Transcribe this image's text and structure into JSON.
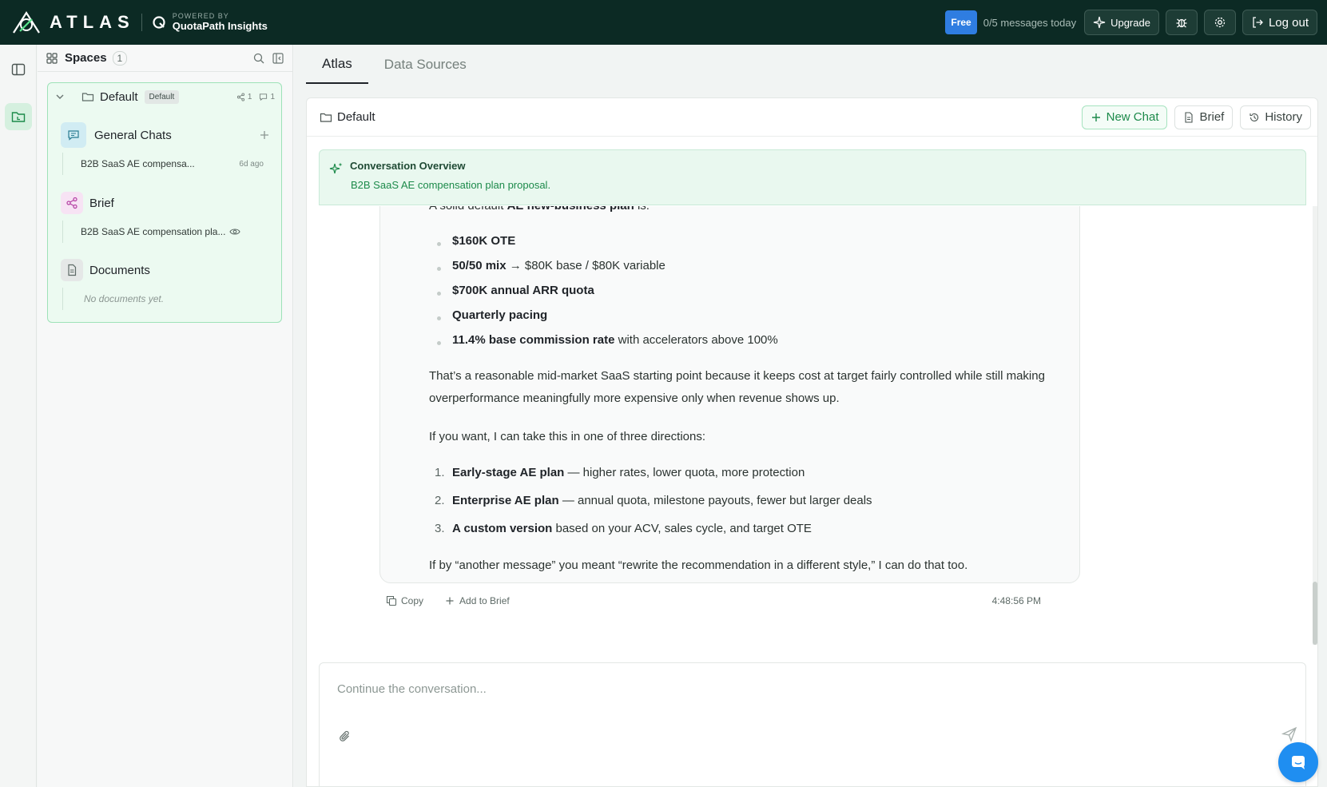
{
  "brand": {
    "name": "ATLAS",
    "powered_by": "POWERED BY",
    "partner": "QuotaPath Insights"
  },
  "topbar": {
    "plan_badge": "Free",
    "message_count": "0/5 messages today",
    "upgrade_label": "Upgrade",
    "logout_label": "Log out",
    "icons": [
      "bug-icon",
      "gear-icon",
      "logout-icon"
    ]
  },
  "sidebar": {
    "title": "Spaces",
    "count": "1",
    "space": {
      "name": "Default",
      "badge": "Default",
      "share_count": "1",
      "chat_count": "1"
    },
    "sections": [
      {
        "title": "General Chats",
        "items": [
          {
            "label": "B2B SaaS AE compensa...",
            "time": "6d ago"
          }
        ]
      },
      {
        "title": "Brief",
        "items": [
          {
            "label": "B2B SaaS AE compensation pla..."
          }
        ]
      },
      {
        "title": "Documents",
        "empty": "No documents yet."
      }
    ]
  },
  "main": {
    "tabs": [
      {
        "label": "Atlas",
        "active": true
      },
      {
        "label": "Data Sources",
        "active": false
      }
    ],
    "panel_title": "Default",
    "actions": {
      "new_chat": "New Chat",
      "brief": "Brief",
      "history": "History"
    },
    "overview": {
      "title": "Conversation Overview",
      "text": "B2B SaaS AE compensation plan proposal."
    },
    "message": {
      "intro_pre": "A solid default ",
      "intro_bold": "AE new-business plan",
      "intro_post": " is:",
      "bullets": [
        {
          "bold": "$160K OTE",
          "rest": ""
        },
        {
          "bold": "50/50 mix",
          "rest": " → $80K base / $80K variable"
        },
        {
          "bold": "$700K annual ARR quota",
          "rest": ""
        },
        {
          "bold": "Quarterly pacing",
          "rest": ""
        },
        {
          "bold": "11.4% base commission rate",
          "rest": " with accelerators above 100%"
        }
      ],
      "para1_line1": "That’s a reasonable mid-market SaaS starting point because it keeps cost at target fairly controlled while still making",
      "para1_line2": "overperformance meaningfully more expensive only when revenue shows up.",
      "para2": "If you want, I can take this in one of three directions:",
      "options": [
        {
          "num": "1.",
          "bold": "Early-stage AE plan",
          "rest": " — higher rates, lower quota, more protection"
        },
        {
          "num": "2.",
          "bold": "Enterprise AE plan",
          "rest": " — annual quota, milestone payouts, fewer but larger deals"
        },
        {
          "num": "3.",
          "bold": "A custom version",
          "rest": " based on your ACV, sales cycle, and target OTE"
        }
      ],
      "closing": "If by “another message” you meant “rewrite the recommendation in a different style,” I can do that too.",
      "copy_label": "Copy",
      "add_label": "Add to Brief",
      "timestamp": "4:48:56 PM"
    },
    "composer": {
      "placeholder": "Continue the conversation..."
    }
  },
  "colors": {
    "topbar_bg": "#0c2a24",
    "accent_green": "#1c8a4a",
    "free_badge": "#2f7de1",
    "chat_fab": "#1f8ef1"
  }
}
